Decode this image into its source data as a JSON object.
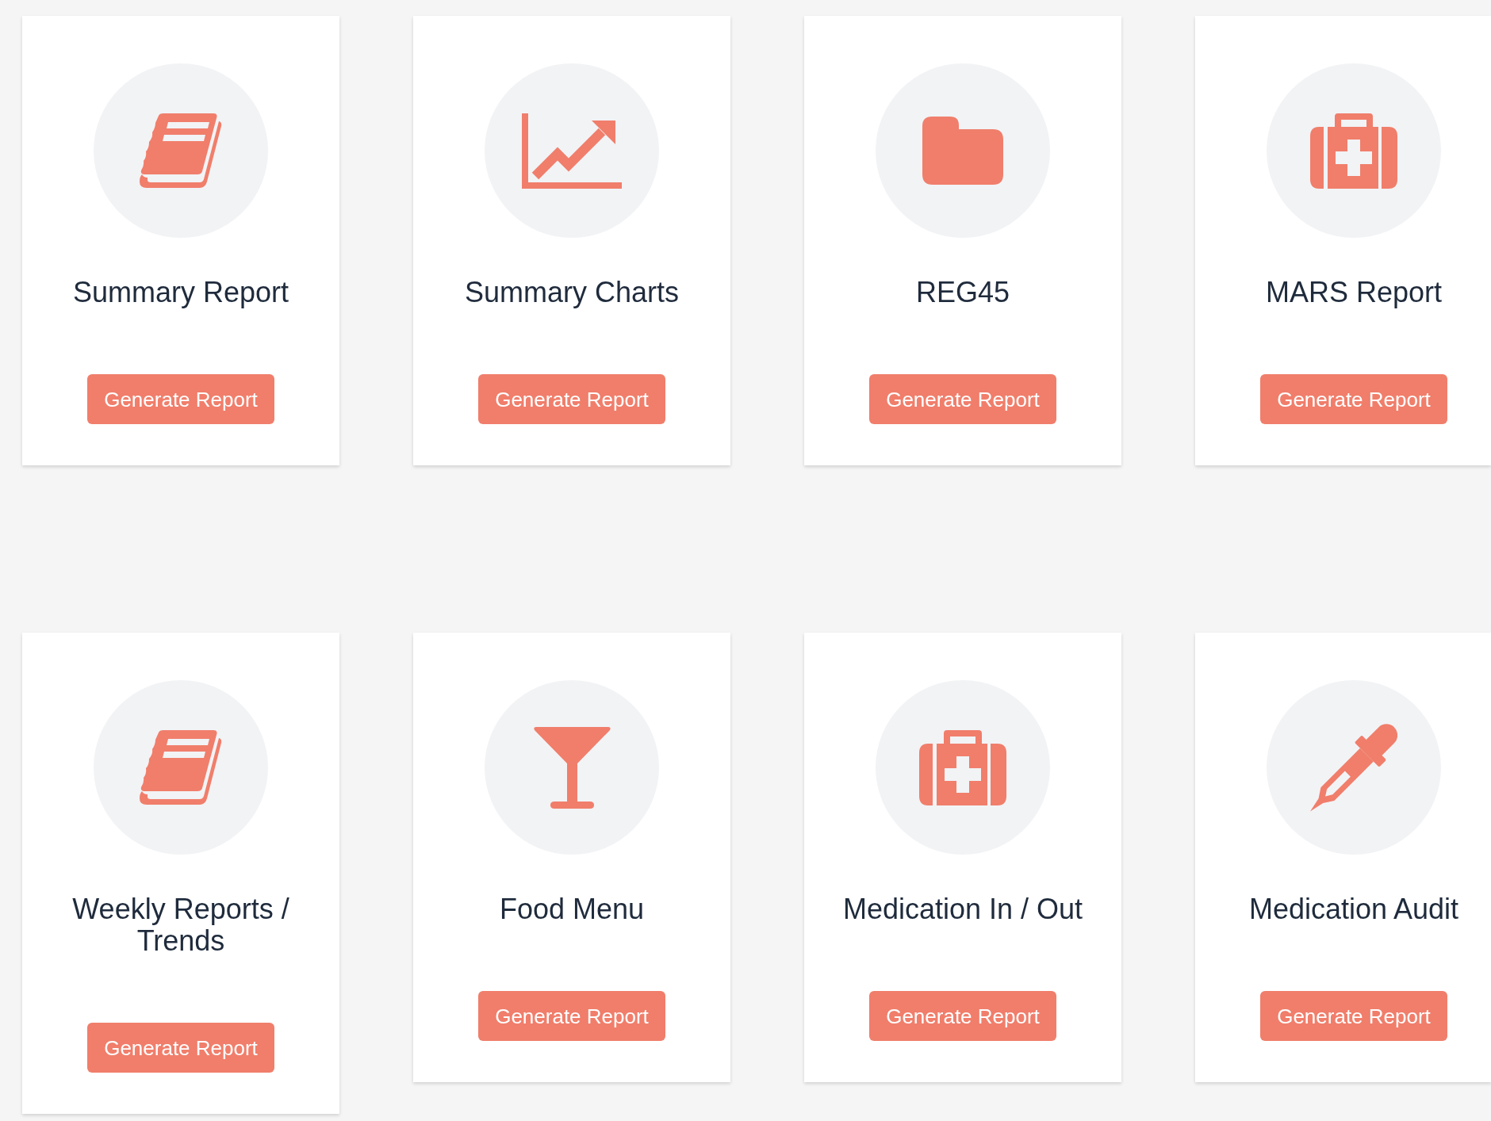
{
  "cards": [
    {
      "kind": "book",
      "title": "Summary Report",
      "button": "Generate Report"
    },
    {
      "kind": "chart",
      "title": "Summary Charts",
      "button": "Generate Report"
    },
    {
      "kind": "folder",
      "title": "REG45",
      "button": "Generate Report"
    },
    {
      "kind": "medkit",
      "title": "MARS Report",
      "button": "Generate Report"
    },
    {
      "kind": "book",
      "title": "Weekly Reports / Trends",
      "button": "Generate Report"
    },
    {
      "kind": "glass",
      "title": "Food Menu",
      "button": "Generate Report"
    },
    {
      "kind": "medkit",
      "title": "Medication In / Out",
      "button": "Generate Report"
    },
    {
      "kind": "dropper",
      "title": "Medication Audit",
      "button": "Generate Report"
    }
  ]
}
